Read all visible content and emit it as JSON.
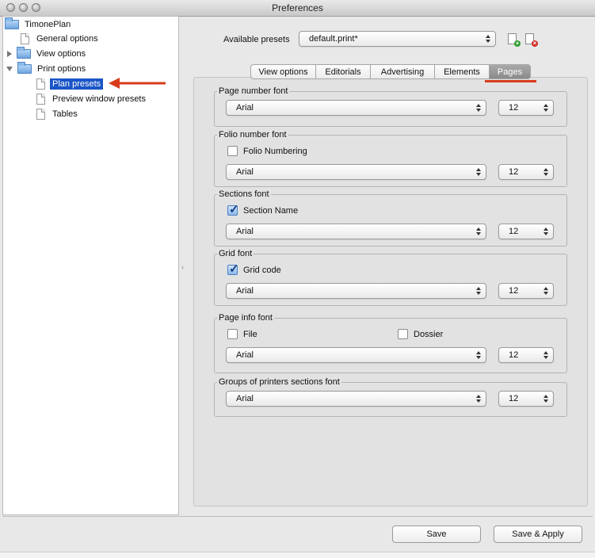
{
  "window": {
    "title": "Preferences"
  },
  "sidebar": {
    "root": "TimonePlan",
    "items": [
      {
        "label": "General options",
        "icon": "document-icon"
      },
      {
        "label": "View options",
        "icon": "folder-icon",
        "expander": "collapsed"
      },
      {
        "label": "Print options",
        "icon": "folder-icon",
        "expander": "expanded"
      },
      {
        "label": "Plan presets",
        "icon": "document-icon",
        "selected": true
      },
      {
        "label": "Preview window presets",
        "icon": "document-icon"
      },
      {
        "label": "Tables",
        "icon": "document-icon"
      }
    ]
  },
  "presets": {
    "label": "Available presets",
    "value": "default.print*",
    "add_icon": "add-preset-icon",
    "remove_icon": "remove-preset-icon"
  },
  "tabs": [
    {
      "label": "View options"
    },
    {
      "label": "Editorials"
    },
    {
      "label": "Advertising"
    },
    {
      "label": "Elements"
    },
    {
      "label": "Pages",
      "active": true
    }
  ],
  "groups": {
    "page_number": {
      "title": "Page number font",
      "font": "Arial",
      "size": "12"
    },
    "folio_number": {
      "title": "Folio number font",
      "checkbox": "Folio Numbering",
      "checked": false,
      "font": "Arial",
      "size": "12"
    },
    "sections": {
      "title": "Sections font",
      "checkbox": "Section Name",
      "checked": true,
      "font": "Arial",
      "size": "12"
    },
    "grid": {
      "title": "Grid font",
      "checkbox": "Grid code",
      "checked": true,
      "font": "Arial",
      "size": "12"
    },
    "page_info": {
      "title": "Page info font",
      "checkbox_file": "File",
      "checkbox_dossier": "Dossier",
      "font": "Arial",
      "size": "12"
    },
    "printers_sections": {
      "title": "Groups of printers sections font",
      "font": "Arial",
      "size": "12"
    }
  },
  "buttons": {
    "save": "Save",
    "save_apply": "Save & Apply"
  },
  "colors": {
    "selection": "#1a55c6",
    "annotation": "#d83a1c",
    "active_tab": "#999999"
  }
}
